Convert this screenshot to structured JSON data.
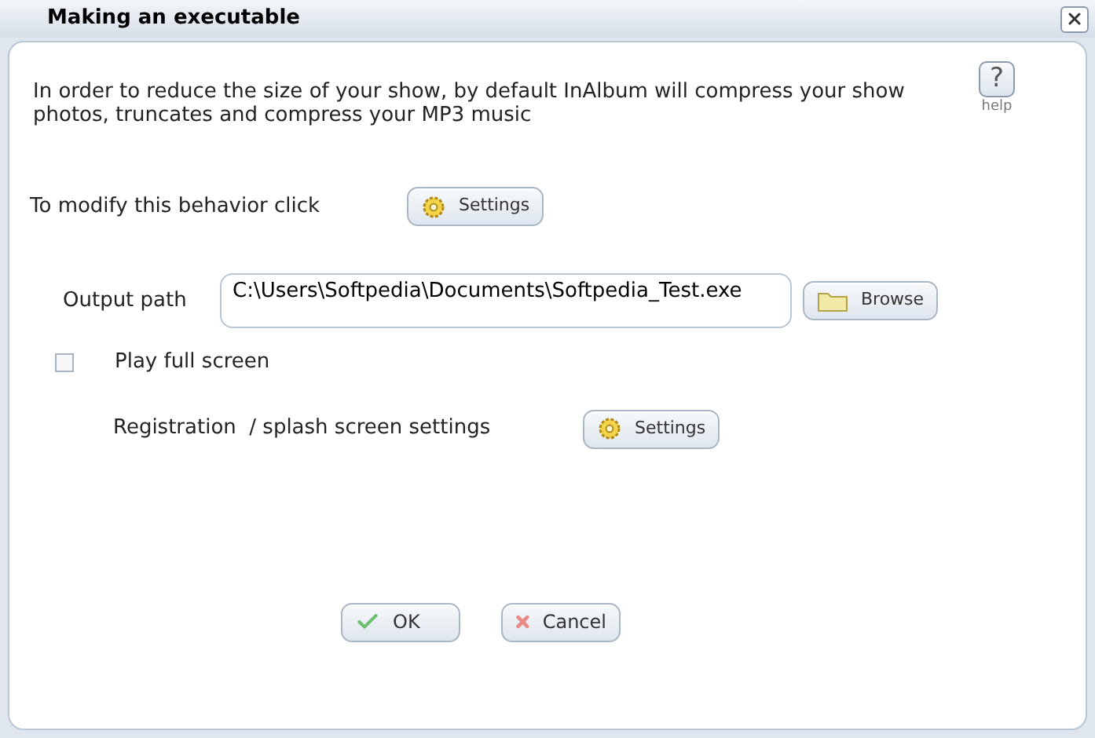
{
  "window": {
    "title": "Making an executable"
  },
  "description": "In order to reduce the size of your show, by default InAlbum will compress your show photos, truncates and compress your MP3 music",
  "help": {
    "glyph": "?",
    "label": "help"
  },
  "modify": {
    "label": "To modify this behavior click",
    "button": "Settings"
  },
  "output": {
    "label": "Output path",
    "value": "C:\\Users\\Softpedia\\Documents\\Softpedia_Test.exe",
    "button": "Browse"
  },
  "full_screen": {
    "label": "Play full screen",
    "checked": false
  },
  "registration": {
    "label": "Registration  / splash screen settings",
    "button": "Settings"
  },
  "buttons": [
    {
      "kind": "ok",
      "label": "OK"
    },
    {
      "kind": "cancel",
      "label": "Cancel"
    }
  ]
}
